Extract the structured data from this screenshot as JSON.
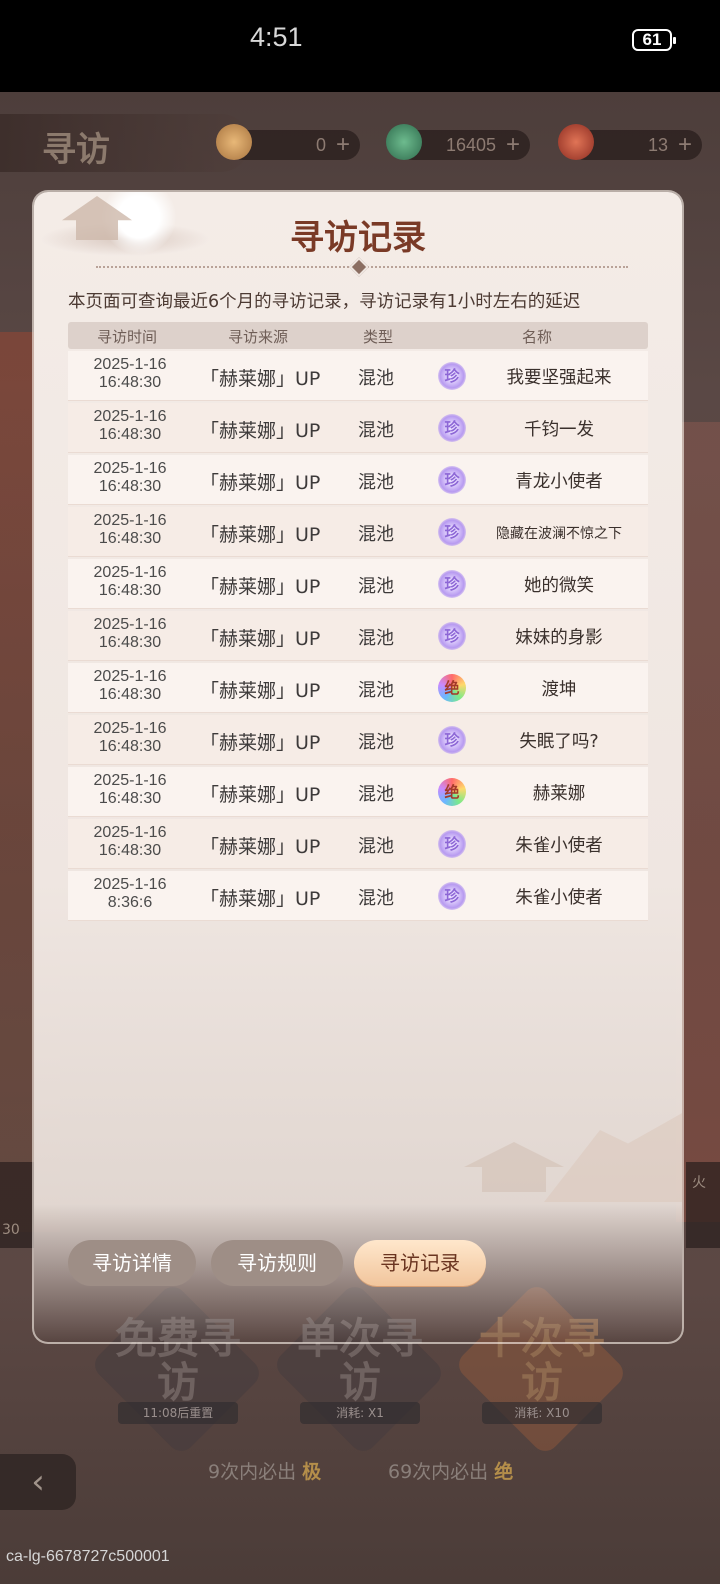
{
  "status_bar": {
    "time": "4:51",
    "battery": "61"
  },
  "game": {
    "title": "寻访",
    "resources": [
      {
        "icon": "peach-token-icon",
        "value": "0",
        "color": "#d9a35c"
      },
      {
        "icon": "jade-gem-icon",
        "value": "16405",
        "color": "#4f9a72"
      },
      {
        "icon": "red-feather-icon",
        "value": "13",
        "color": "#c8473a"
      }
    ],
    "draw_buttons": [
      {
        "label": "免费寻访",
        "sub": "11:08后重置"
      },
      {
        "label": "单次寻访",
        "sub": "消耗: X1"
      },
      {
        "label": "十次寻访",
        "sub": "消耗: X10"
      }
    ],
    "guarantees": [
      {
        "text": "9次内必出",
        "badge": "极"
      },
      {
        "text": "69次内必出",
        "badge": "绝"
      }
    ],
    "ticker_left": "30",
    "ticker_right": "火",
    "build_id": "ca-lg-6678727c500001"
  },
  "modal": {
    "title": "寻访记录",
    "notice": "本页面可查询最近6个月的寻访记录，寻访记录有1小时左右的延迟",
    "columns": [
      "寻访时间",
      "寻访来源",
      "类型",
      "名称"
    ],
    "rows": [
      {
        "date": "2025-1-16",
        "time": "16:48:30",
        "source": "「赫莱娜」UP",
        "type": "混池",
        "rarity": "珍",
        "name": "我要坚强起来"
      },
      {
        "date": "2025-1-16",
        "time": "16:48:30",
        "source": "「赫莱娜」UP",
        "type": "混池",
        "rarity": "珍",
        "name": "千钧一发"
      },
      {
        "date": "2025-1-16",
        "time": "16:48:30",
        "source": "「赫莱娜」UP",
        "type": "混池",
        "rarity": "珍",
        "name": "青龙小使者"
      },
      {
        "date": "2025-1-16",
        "time": "16:48:30",
        "source": "「赫莱娜」UP",
        "type": "混池",
        "rarity": "珍",
        "name": "隐藏在波澜不惊之下"
      },
      {
        "date": "2025-1-16",
        "time": "16:48:30",
        "source": "「赫莱娜」UP",
        "type": "混池",
        "rarity": "珍",
        "name": "她的微笑"
      },
      {
        "date": "2025-1-16",
        "time": "16:48:30",
        "source": "「赫莱娜」UP",
        "type": "混池",
        "rarity": "珍",
        "name": "妹妹的身影"
      },
      {
        "date": "2025-1-16",
        "time": "16:48:30",
        "source": "「赫莱娜」UP",
        "type": "混池",
        "rarity": "绝",
        "name": "渡坤"
      },
      {
        "date": "2025-1-16",
        "time": "16:48:30",
        "source": "「赫莱娜」UP",
        "type": "混池",
        "rarity": "珍",
        "name": "失眠了吗?"
      },
      {
        "date": "2025-1-16",
        "time": "16:48:30",
        "source": "「赫莱娜」UP",
        "type": "混池",
        "rarity": "绝",
        "name": "赫莱娜"
      },
      {
        "date": "2025-1-16",
        "time": "16:48:30",
        "source": "「赫莱娜」UP",
        "type": "混池",
        "rarity": "珍",
        "name": "朱雀小使者"
      },
      {
        "date": "2025-1-16",
        "time": "8:36:6",
        "source": "「赫莱娜」UP",
        "type": "混池",
        "rarity": "珍",
        "name": "朱雀小使者"
      }
    ],
    "tabs": [
      {
        "label": "寻访详情",
        "active": false
      },
      {
        "label": "寻访规则",
        "active": false
      },
      {
        "label": "寻访记录",
        "active": true
      }
    ]
  }
}
